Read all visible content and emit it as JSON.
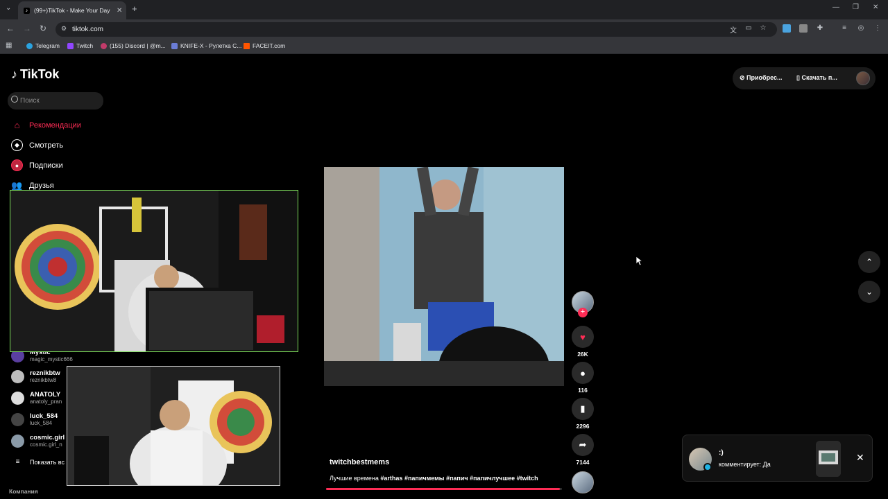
{
  "browser": {
    "tab_title": "(99+)TikTok - Make Your Day",
    "tab_favicon": "tiktok-icon",
    "url": "tiktok.com",
    "bookmarks": [
      "Telegram",
      "Twitch",
      "(155) Discord | @m...",
      "KNIFE-X - Рулетка С...",
      "FACEIT.com"
    ]
  },
  "tiktok": {
    "logo": "TikTok",
    "search_placeholder": "Поиск",
    "nav": {
      "recommendations": "Рекомендации",
      "watch": "Смотреть",
      "subscriptions": "Подписки",
      "friends": "Друзья"
    },
    "topbar": {
      "buy_label": "Приобрес...",
      "download_label": "Скачать п..."
    },
    "following": [
      {
        "name": "Mystic",
        "user": "magic_mystic666"
      },
      {
        "name": "reznikbtw",
        "user": "reznikbtw8"
      },
      {
        "name": "ANATOLY",
        "user": "anatoly_pran"
      },
      {
        "name": "luck_584",
        "user": "luck_584"
      },
      {
        "name": "cosmic.girl",
        "user": "cosmic.girl_n"
      }
    ],
    "show_all": "Показать вс",
    "company": "Компания",
    "video": {
      "author": "twitchbestmems",
      "caption": "Лучшие времена ",
      "hashtags": "#arthas #папичмемы #папич #папичлучшее #twitch",
      "progress_fraction": 0.99
    },
    "actions": {
      "likes": "26K",
      "comments": "116",
      "saves": "2296",
      "shares": "7144"
    },
    "notification": {
      "title": ":)",
      "subtitle": "комментирует: Да"
    }
  }
}
